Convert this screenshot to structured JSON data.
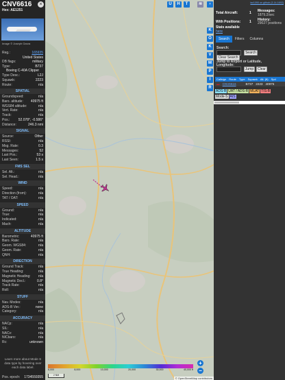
{
  "aircraft": {
    "callsign": "CNV6616",
    "hex_label": "Hex:",
    "hex": "AE1251",
    "photo_credit": "Image © Joseph Garza",
    "close_label": "×"
  },
  "basic_rows": [
    {
      "k": "Reg.:",
      "v": "165935",
      "link": true
    },
    {
      "k": "",
      "v": "United States"
    },
    {
      "k": "DB flags:",
      "v": "military"
    },
    {
      "k": "Type:",
      "v": "B737"
    }
  ],
  "type_name": "Boeing C-40A Clipper",
  "basic_rows2": [
    {
      "k": "Type Desc.:",
      "v": "L2J"
    },
    {
      "k": "Squawk:",
      "v": "2223"
    },
    {
      "k": "Route:",
      "v": "n/a"
    }
  ],
  "sections": {
    "spatial": {
      "title": "SPATIAL",
      "rows": [
        {
          "k": "Groundspeed:",
          "v": "n/a"
        },
        {
          "k": "Baro. altitude:",
          "v": "40975 ft"
        },
        {
          "k": "WGS84 altitude:",
          "v": "n/a"
        },
        {
          "k": "Vert. Rate:",
          "v": "n/a"
        },
        {
          "k": "Track:",
          "v": "n/a"
        },
        {
          "k": "Pos.:",
          "v": "52.078°, -0.586°"
        },
        {
          "k": "Distance:",
          "v": "246.3 nmi"
        }
      ]
    },
    "signal": {
      "title": "SIGNAL",
      "rows": [
        {
          "k": "Source:",
          "v": "Other"
        },
        {
          "k": "RSSI:",
          "v": "n/a"
        },
        {
          "k": "Msg. Rate:",
          "v": "0.3"
        },
        {
          "k": "Messages:",
          "v": "52"
        },
        {
          "k": "Last Pos.:",
          "v": "53 s"
        },
        {
          "k": "Last Seen:",
          "v": "1.5 s"
        }
      ]
    },
    "fms": {
      "title": "FMS SEL",
      "rows": [
        {
          "k": "Sel. Alt.:",
          "v": "n/a"
        },
        {
          "k": "Sel. Head.:",
          "v": "n/a"
        }
      ]
    },
    "wind": {
      "title": "WIND",
      "rows": [
        {
          "k": "Speed:",
          "v": "n/a"
        },
        {
          "k": "Direction (from):",
          "v": "n/a"
        },
        {
          "k": "TAT / OAT:",
          "v": "n/a"
        }
      ]
    },
    "speed": {
      "title": "SPEED",
      "rows": [
        {
          "k": "Ground:",
          "v": "n/a"
        },
        {
          "k": "True:",
          "v": "n/a"
        },
        {
          "k": "Indicated:",
          "v": "n/a"
        },
        {
          "k": "Mach:",
          "v": "n/a"
        }
      ]
    },
    "altitude": {
      "title": "ALTITUDE",
      "rows": [
        {
          "k": "Barometric:",
          "v": "40975 ft"
        },
        {
          "k": "Baro. Rate:",
          "v": "n/a"
        },
        {
          "k": "Geom. WGS84:",
          "v": "n/a"
        },
        {
          "k": "Geom. Rate:",
          "v": "n/a"
        },
        {
          "k": "QNH:",
          "v": "n/a"
        }
      ]
    },
    "direction": {
      "title": "DIRECTION",
      "rows": [
        {
          "k": "Ground Track:",
          "v": "n/a"
        },
        {
          "k": "True Heading:",
          "v": "n/a"
        },
        {
          "k": "Magnetic Heading:",
          "v": "n/a"
        },
        {
          "k": "Magnetic Decl.:",
          "v": "0.8°"
        },
        {
          "k": "Track Rate:",
          "v": "n/a"
        },
        {
          "k": "Roll:",
          "v": "n/a"
        }
      ]
    },
    "stuff": {
      "title": "STUFF",
      "rows": [
        {
          "k": "Nav. Modes:",
          "v": "n/a"
        },
        {
          "k": "ADS-B Ver.:",
          "v": "none"
        },
        {
          "k": "Category:",
          "v": "n/a"
        }
      ]
    },
    "accuracy": {
      "title": "ACCURACY",
      "rows": [
        {
          "k": "NACp:",
          "v": "n/a"
        },
        {
          "k": "SIL:",
          "v": "n/a"
        },
        {
          "k": "NACv:",
          "v": "n/a"
        },
        {
          "k": "NICbaro:",
          "v": "n/a"
        },
        {
          "k": "Rc:",
          "v": "unknown"
        }
      ]
    }
  },
  "note": "Learn more about Mode S data type by hovering over each data label.",
  "pos_epoch": {
    "k": "Pos. epoch:",
    "v": "1734559355"
  },
  "map": {
    "top_buttons": [
      "U",
      "H",
      "T"
    ],
    "side_buttons": [
      "K",
      "O",
      "K",
      "V",
      "M",
      "P",
      "I",
      "R"
    ],
    "legend": [
      "6,000",
      "8,000",
      "10,000",
      "20,000",
      "30,000",
      "40,000 ft"
    ],
    "scale": "2 NM",
    "attribution": "© OpenStreetMap contributors",
    "zoom_in": "+",
    "zoom_out": "−",
    "colors": {
      "land": "#c7cec0",
      "water": "#aac3d9",
      "road": "#e9c47a",
      "aircraft": "#c03090"
    }
  },
  "right": {
    "topnav_pre": "",
    "topnav_link": "tar1090 on github (3.14.1692)",
    "total_label": "Total Aircraft:",
    "total_value": "1",
    "messages_label": "Messages:",
    "messages_value": "1879.2/sec",
    "positions_label": "With Positions:",
    "positions_value": "1",
    "history_label": "History:",
    "history_value": "29027 positions",
    "stats_label": "Stats available",
    "stats_link": "here",
    "tabs": [
      "Search",
      "Filters",
      "Columns"
    ],
    "search_label": "Search:",
    "search_button": "Search",
    "clear_search": "Clear Search",
    "jump_label": "Jump to Airport or Latitude, Longitude:",
    "jump_button": "Jump",
    "clear_button": "Clear",
    "table_headers": [
      "Callsign",
      "Route",
      "Type",
      "Squawk",
      "Alt. (ft)",
      "Spd"
    ],
    "table_row": [
      "CNV6616",
      "",
      "B737",
      "2223",
      "40975",
      ""
    ],
    "sources": [
      {
        "label": "ADS-B",
        "color": "#8fe3ff"
      },
      {
        "label": "UAT / ADS-R",
        "color": "#c6e0a0"
      },
      {
        "label": "MLAT",
        "color": "#f2b25c"
      },
      {
        "label": "TIS-B",
        "color": "#f37f7f"
      }
    ],
    "sources2": [
      {
        "label": "Mode-S",
        "color": "#dddddd"
      },
      {
        "label": "AIS",
        "color": "#a0a0ff"
      }
    ]
  }
}
